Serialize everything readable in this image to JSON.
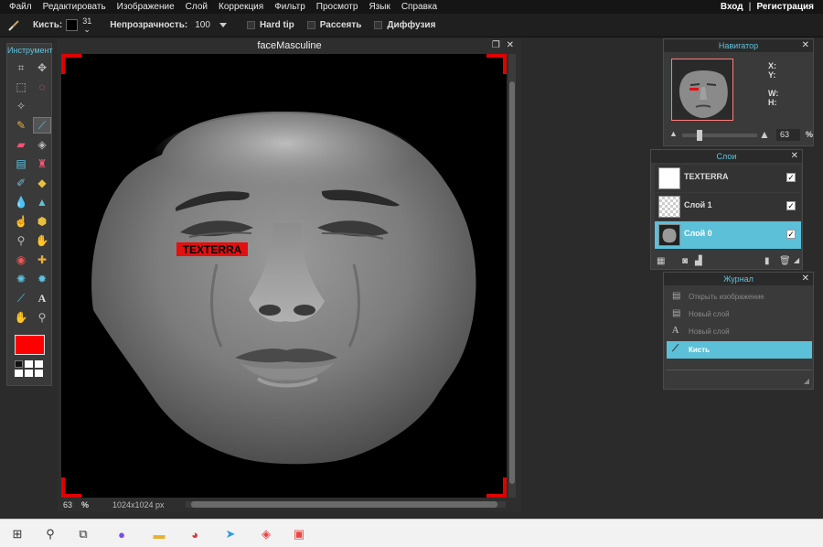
{
  "menu": {
    "items": [
      "Файл",
      "Редактировать",
      "Изображение",
      "Слой",
      "Коррекция",
      "Фильтр",
      "Просмотр",
      "Язык",
      "Справка"
    ],
    "login": "Вход",
    "separator": "|",
    "register": "Регистрация"
  },
  "options": {
    "brush_label": "Кисть:",
    "brush_color": "#000000",
    "brush_size": "31",
    "opacity_label": "Непрозрачность:",
    "opacity_value": "100",
    "hard_tip": "Hard tip",
    "scatter": "Рассеять",
    "diffusion": "Диффузия"
  },
  "tools": {
    "title": "Инструмент",
    "icons": [
      "crop-icon",
      "move-icon",
      "marquee-icon",
      "lasso-icon",
      "magic-wand-icon",
      "",
      "pencil-icon",
      "brush-icon",
      "eraser-icon",
      "bucket-icon",
      "gradient-icon",
      "stamp-icon",
      "color-replace-icon",
      "shape-icon",
      "dropper-icon",
      "sharpen-icon",
      "smudge-icon",
      "sponge-icon",
      "burn-icon",
      "dodge-icon",
      "red-eye-icon",
      "spot-heal-icon",
      "bloat-icon",
      "pinch-icon",
      "picker-icon",
      "type-icon",
      "hand-icon",
      "zoom-icon"
    ],
    "foreground_color": "#ff0000"
  },
  "document": {
    "title": "faceMasculine",
    "overlay_text": "TEXTERRA",
    "zoom": "63",
    "zoom_unit": "%",
    "dimensions": "1024x1024 px"
  },
  "navigator": {
    "title": "Навигатор",
    "x_label": "X:",
    "y_label": "Y:",
    "w_label": "W:",
    "h_label": "H:",
    "zoom": "63",
    "zoom_unit": "%"
  },
  "layers": {
    "title": "Слои",
    "items": [
      {
        "name": "TEXTERRA",
        "visible": true,
        "selected": false
      },
      {
        "name": "Слой 1",
        "visible": true,
        "selected": false
      },
      {
        "name": "Слой 0",
        "visible": true,
        "selected": true
      }
    ]
  },
  "journal": {
    "title": "Журнал",
    "items": [
      {
        "label": "Открыть изображение",
        "selected": false
      },
      {
        "label": "Новый слой",
        "selected": false
      },
      {
        "label": "Новый слой",
        "selected": false
      },
      {
        "label": "Кисть",
        "selected": true
      }
    ]
  },
  "colors": {
    "accent": "#5bc0d8",
    "panel_title": "#5fc2dc",
    "frame_corner": "#e00000"
  }
}
